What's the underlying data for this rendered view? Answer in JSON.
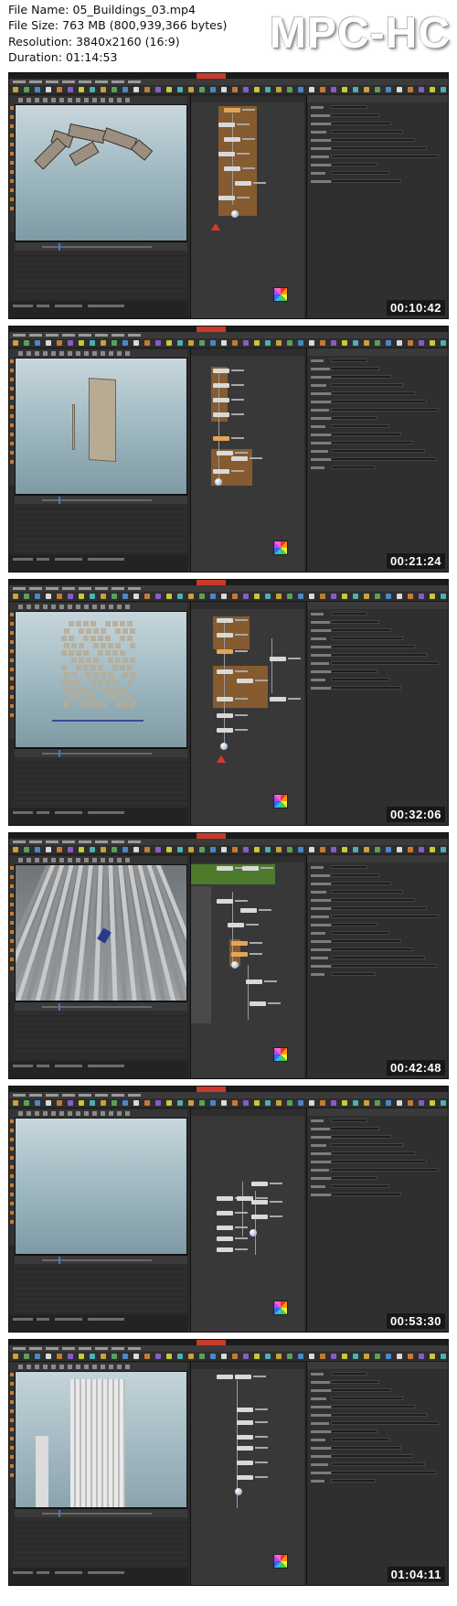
{
  "file_info": {
    "file_name": "File Name: 05_Buildings_03.mp4",
    "file_size": "File Size: 763 MB (800,939,366 bytes)",
    "resolution": "Resolution: 3840x2160 (16:9)",
    "duration": "Duration: 01:14:53"
  },
  "player_brand": "MPC-HC",
  "thumbnails": [
    {
      "timestamp": "00:10:42"
    },
    {
      "timestamp": "00:21:24"
    },
    {
      "timestamp": "00:32:06"
    },
    {
      "timestamp": "00:42:48"
    },
    {
      "timestamp": "00:53:30"
    },
    {
      "timestamp": "01:04:11"
    }
  ],
  "colors": {
    "ui_dark": "#2a2a2a",
    "node_network_orange": "#c47828",
    "error_red": "#d43b2b"
  }
}
